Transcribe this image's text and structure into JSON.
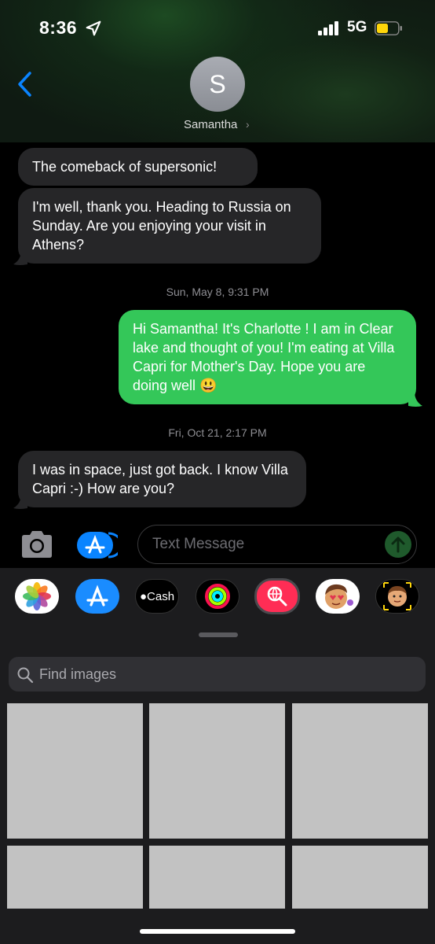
{
  "status_bar": {
    "time": "8:36",
    "network": "5G"
  },
  "header": {
    "avatar_initial": "S",
    "contact_name": "Samantha",
    "chevron": "›"
  },
  "messages": [
    {
      "type": "received",
      "text": "The comeback of supersonic!"
    },
    {
      "type": "received",
      "text": "I'm well, thank you. Heading to Russia on Sunday. Are you enjoying your visit in Athens?"
    },
    {
      "type": "timestamp",
      "text": "Sun, May 8, 9:31 PM"
    },
    {
      "type": "sent",
      "text": "Hi Samantha! It's Charlotte ! I am in Clear lake and thought of you! I'm eating at Villa Capri for Mother's Day. Hope you are doing well 😃"
    },
    {
      "type": "timestamp",
      "text": "Fri, Oct 21, 2:17 PM"
    },
    {
      "type": "received",
      "text": "I was in space, just got back. I know Villa Capri   :-)  How are you?"
    }
  ],
  "input": {
    "placeholder": "Text Message"
  },
  "apps": [
    {
      "name": "photos-icon"
    },
    {
      "name": "app-store-icon"
    },
    {
      "name": "apple-cash-icon",
      "label": "Cash"
    },
    {
      "name": "activity-icon"
    },
    {
      "name": "image-search-icon"
    },
    {
      "name": "memoji-stickers-icon"
    },
    {
      "name": "memoji-icon"
    }
  ],
  "drawer": {
    "search_placeholder": "Find images"
  },
  "colors": {
    "sent_bubble": "#34c759",
    "received_bubble": "#262628",
    "accent": "#0a84ff"
  }
}
